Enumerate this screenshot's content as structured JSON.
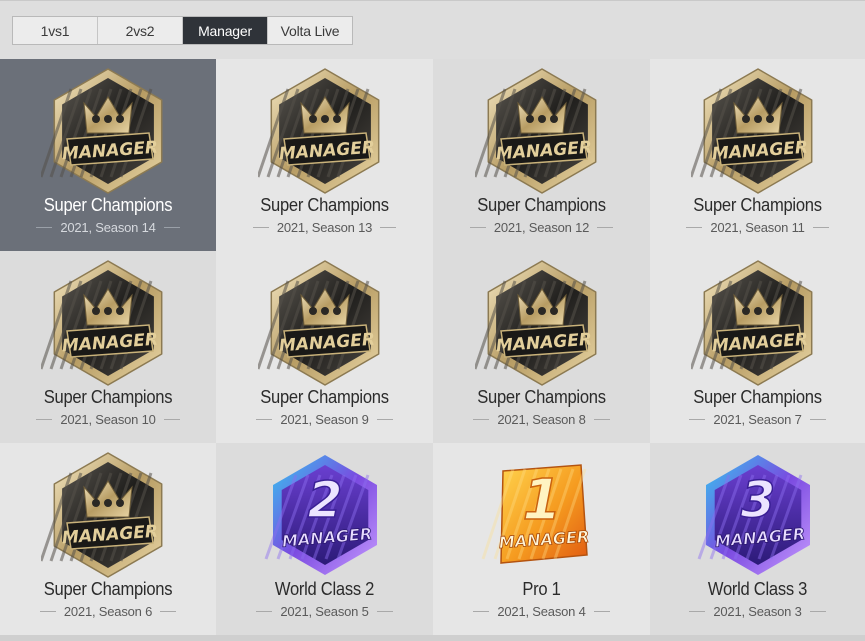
{
  "tabs": [
    {
      "label": "1vs1",
      "active": false
    },
    {
      "label": "2vs2",
      "active": false
    },
    {
      "label": "Manager",
      "active": true
    },
    {
      "label": "Volta Live",
      "active": false
    }
  ],
  "badges": [
    {
      "title": "Super Champions",
      "subtitle": "2021, Season 14",
      "type": "super",
      "text": "MANAGER",
      "selected": true
    },
    {
      "title": "Super Champions",
      "subtitle": "2021, Season 13",
      "type": "super",
      "text": "MANAGER",
      "selected": false
    },
    {
      "title": "Super Champions",
      "subtitle": "2021, Season 12",
      "type": "super",
      "text": "MANAGER",
      "selected": false
    },
    {
      "title": "Super Champions",
      "subtitle": "2021, Season 11",
      "type": "super",
      "text": "MANAGER",
      "selected": false
    },
    {
      "title": "Super Champions",
      "subtitle": "2021, Season 10",
      "type": "super",
      "text": "MANAGER",
      "selected": false
    },
    {
      "title": "Super Champions",
      "subtitle": "2021, Season 9",
      "type": "super",
      "text": "MANAGER",
      "selected": false
    },
    {
      "title": "Super Champions",
      "subtitle": "2021, Season 8",
      "type": "super",
      "text": "MANAGER",
      "selected": false
    },
    {
      "title": "Super Champions",
      "subtitle": "2021, Season 7",
      "type": "super",
      "text": "MANAGER",
      "selected": false
    },
    {
      "title": "Super Champions",
      "subtitle": "2021, Season 6",
      "type": "super",
      "text": "MANAGER",
      "selected": false
    },
    {
      "title": "World Class 2",
      "subtitle": "2021, Season 5",
      "type": "worldclass",
      "numeral": "2",
      "text": "MANAGER",
      "selected": false
    },
    {
      "title": "Pro 1",
      "subtitle": "2021, Season 4",
      "type": "pro",
      "numeral": "1",
      "text": "MANAGER",
      "selected": false
    },
    {
      "title": "World Class 3",
      "subtitle": "2021, Season 3",
      "type": "worldclass",
      "numeral": "3",
      "text": "MANAGER",
      "selected": false
    }
  ],
  "colors": {
    "tab_active_bg": "#2f3339",
    "selected_cell_bg": "#6b7079",
    "super_gold": "#d9c79a",
    "world_class_purple": "#6a3fd0",
    "pro_orange": "#f08a1c"
  },
  "icons": {
    "super": "crown-manager-badge-icon",
    "worldclass": "world-class-manager-badge-icon",
    "pro": "pro-manager-badge-icon"
  }
}
